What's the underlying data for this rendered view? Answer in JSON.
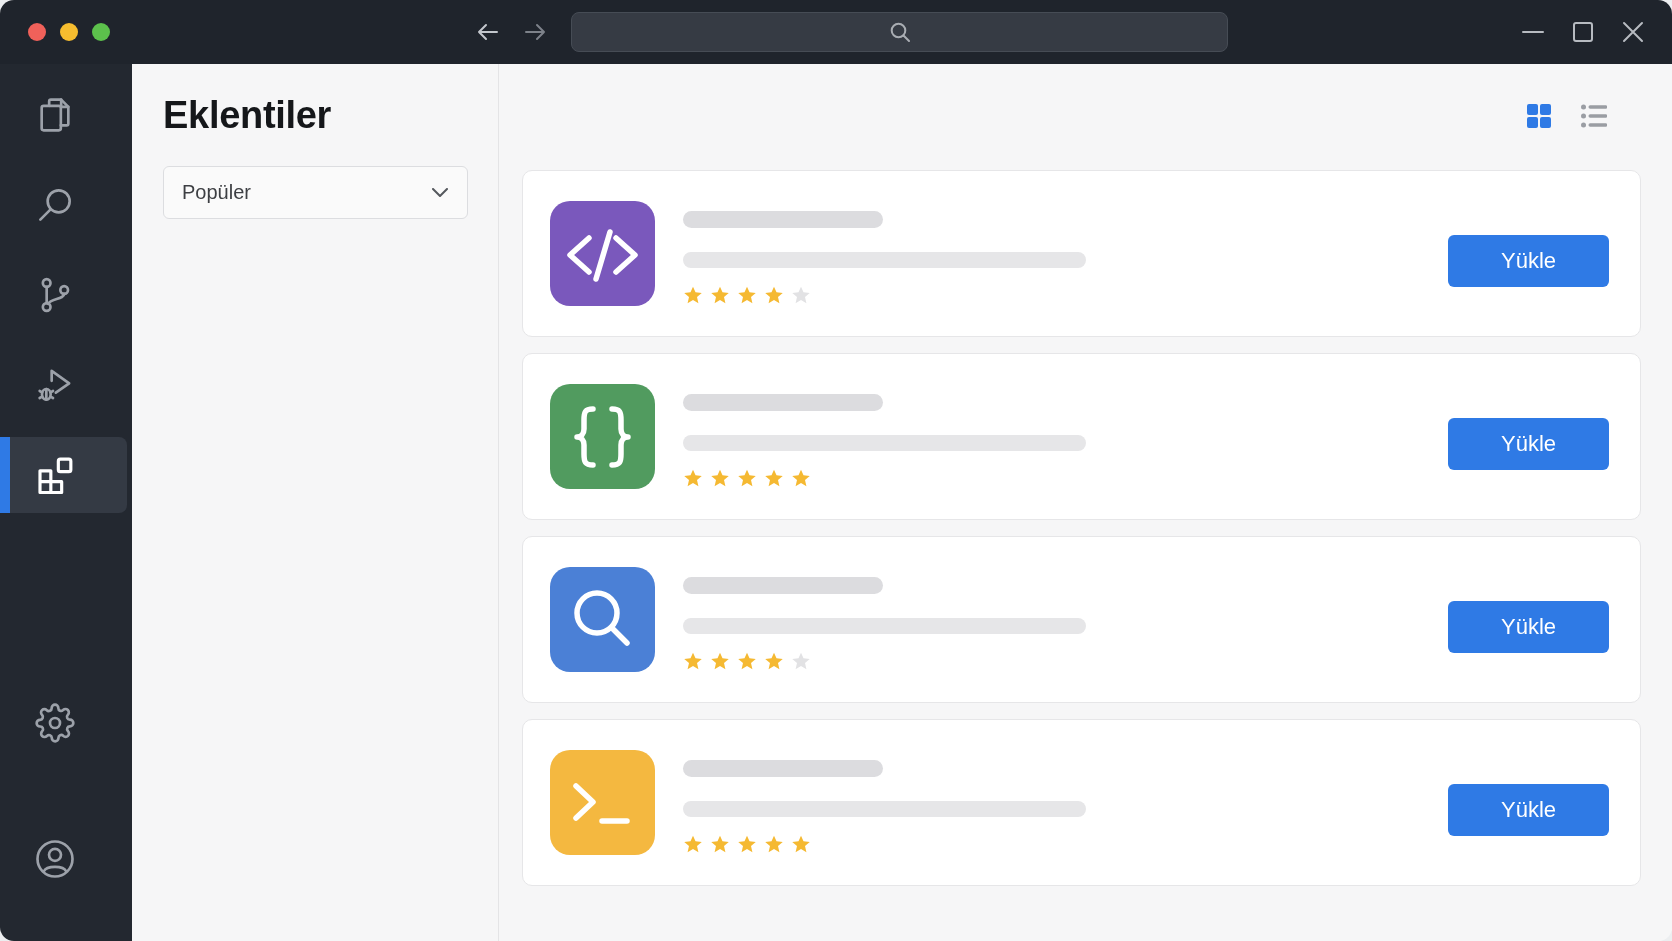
{
  "activity_bar": {
    "items": [
      {
        "selected": false
      },
      {
        "selected": false
      },
      {
        "selected": false
      },
      {
        "selected": false
      },
      {
        "selected": true
      }
    ]
  },
  "panel": {
    "title": "Eklentiler",
    "sort_dropdown": {
      "value": "Popüler"
    }
  },
  "view_toggle": [
    {
      "selected": true
    },
    {
      "selected": false
    }
  ],
  "extensions": [
    {
      "color": "#7a58bc",
      "stars": 4,
      "install_button": "Yükle"
    },
    {
      "color": "#519b5f",
      "stars": 5,
      "install_button": "Yükle"
    },
    {
      "color": "#4b80d6",
      "stars": 4,
      "install_button": "Yükle"
    },
    {
      "color": "#f4b840",
      "stars": 5,
      "install_button": "Yükle"
    }
  ]
}
